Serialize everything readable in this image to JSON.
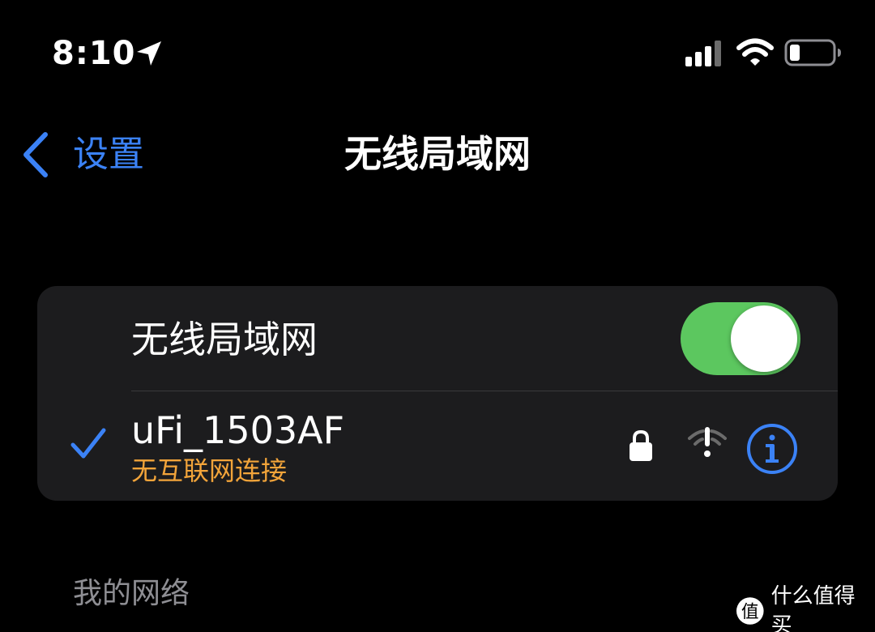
{
  "status_bar": {
    "time": "8:10",
    "location_icon": "location-arrow-icon",
    "signal_icon": "cellular-signal-icon",
    "wifi_icon": "wifi-icon",
    "battery_icon": "battery-low-icon"
  },
  "nav": {
    "back_label": "设置",
    "title": "无线局域网"
  },
  "wifi_toggle": {
    "label": "无线局域网",
    "enabled": true
  },
  "current_network": {
    "name": "uFi_1503AF",
    "status": "无互联网连接",
    "connected": true,
    "secured": true,
    "signal_icon": "wifi-no-internet-icon",
    "info_icon": "info-icon"
  },
  "my_networks_header": "我的网络",
  "watermark": {
    "text": "什么值得买",
    "logo_char": "值"
  },
  "colors": {
    "background": "#000000",
    "card": "#1c1c1e",
    "accent_blue": "#3b82f6",
    "toggle_green": "#5cc75f",
    "warning_orange": "#f2a43a",
    "secondary_text": "#8e8e93"
  }
}
